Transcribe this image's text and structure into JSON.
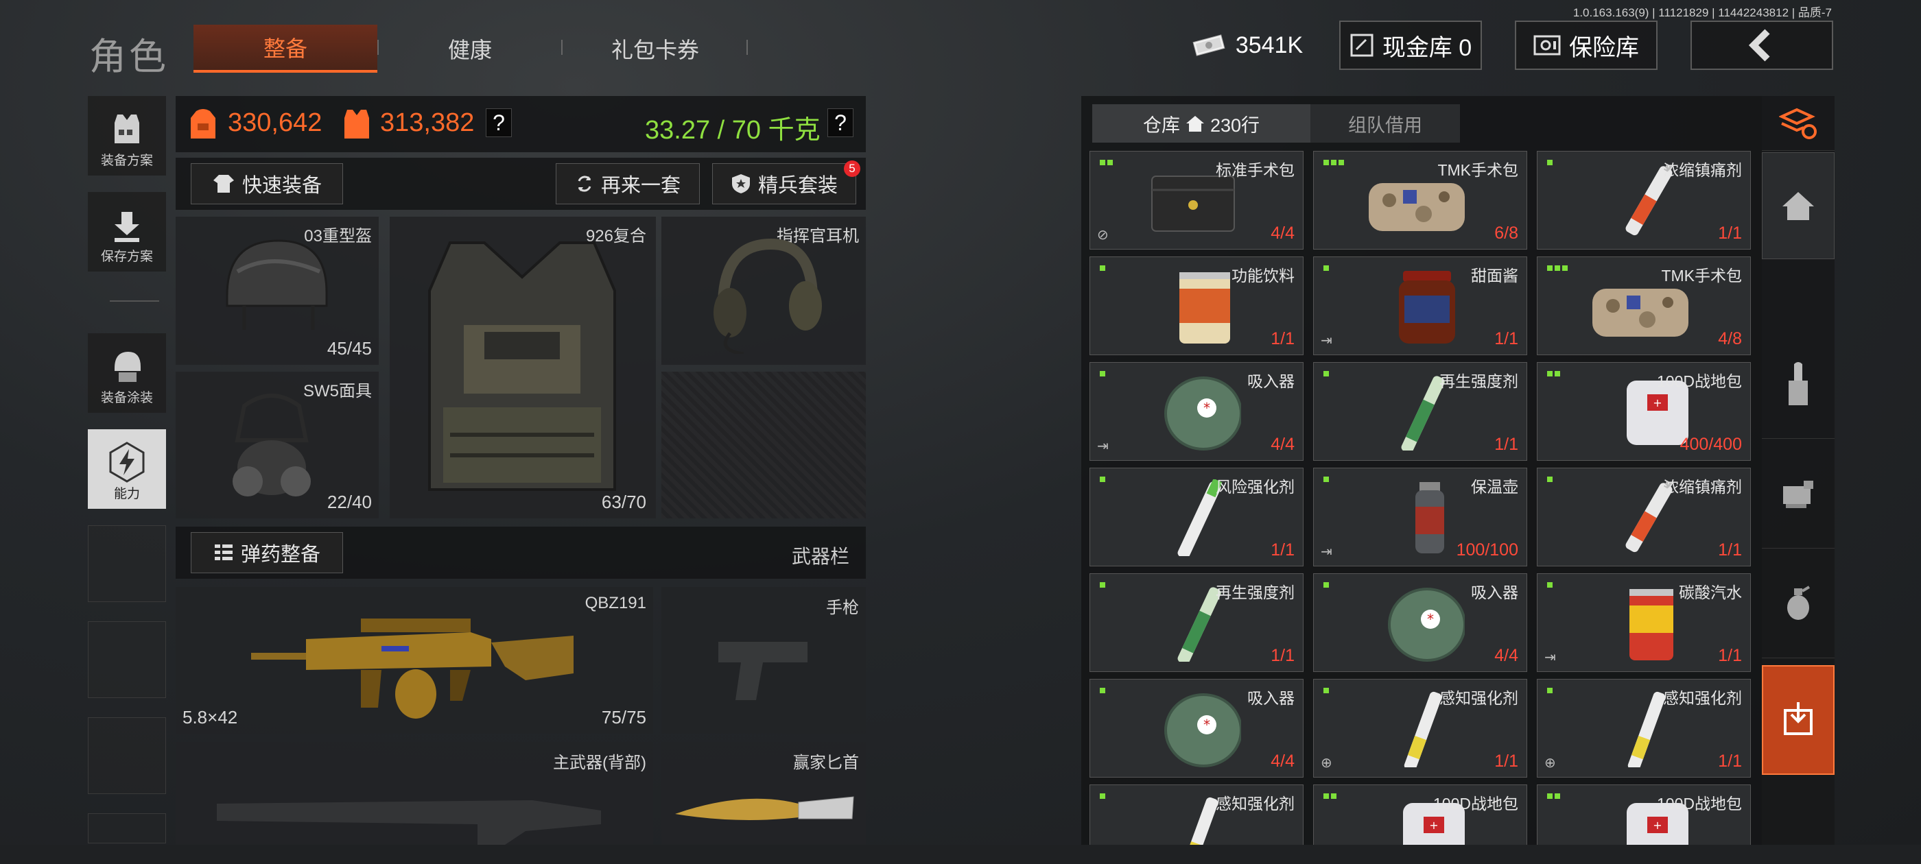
{
  "version": "1.0.163.163(9) | 11121829 | 11442243812 | 品质-7",
  "header": {
    "title": "角色",
    "tabs": [
      {
        "label": "整备",
        "active": true
      },
      {
        "label": "健康",
        "active": false
      },
      {
        "label": "礼包卡券",
        "active": false
      }
    ],
    "money": "3541K",
    "cash_vault": "现金库 0",
    "safe": "保险库"
  },
  "sidebar": [
    {
      "label": "装备方案",
      "icon": "vest-plan-icon"
    },
    {
      "label": "保存方案",
      "icon": "download-icon"
    },
    {
      "label": "装备涂装",
      "icon": "helmet-paint-icon"
    },
    {
      "label": "能力",
      "icon": "lightning-icon"
    }
  ],
  "stats": {
    "value1": "330,642",
    "value2": "313,382",
    "weight": "33.27 / 70 千克",
    "help": "?"
  },
  "actions": {
    "quick_equip": "快速装备",
    "again": "再来一套",
    "elite": "精兵套装",
    "elite_badge": "5"
  },
  "gear": {
    "helmet": {
      "name": "03重型盔",
      "dur": "45/45"
    },
    "armor": {
      "name": "926复合",
      "dur": "63/70"
    },
    "headset": {
      "name": "指挥官耳机"
    },
    "mask": {
      "name": "SW5面具",
      "dur": "22/40"
    }
  },
  "ammo_button": "弹药整备",
  "weapon_bar": "武器栏",
  "weapons": {
    "primary": {
      "name": "QBZ191",
      "caliber": "5.8×42",
      "dur": "75/75"
    },
    "pistol": {
      "name": "手枪"
    },
    "backup": {
      "name": "主武器(背部)"
    },
    "melee": {
      "name": "赢家匕首"
    }
  },
  "storage": {
    "tab1_label": "仓库",
    "tab1_rows": "230行",
    "tab2_label": "组队借用",
    "items": [
      {
        "name": "标准手术包",
        "count": "4/4",
        "grade": 2,
        "art": "black-bag",
        "corner": "⊘"
      },
      {
        "name": "TMK手术包",
        "count": "6/8",
        "grade": 3,
        "art": "camo-bag",
        "corner": ""
      },
      {
        "name": "浓缩镇痛剂",
        "count": "1/1",
        "grade": 1,
        "art": "orange-injector",
        "corner": ""
      },
      {
        "name": "功能饮料",
        "count": "1/1",
        "grade": 1,
        "art": "can",
        "corner": ""
      },
      {
        "name": "甜面酱",
        "count": "1/1",
        "grade": 1,
        "art": "jar",
        "corner": "⇥"
      },
      {
        "name": "TMK手术包",
        "count": "4/8",
        "grade": 3,
        "art": "camo-bag",
        "corner": ""
      },
      {
        "name": "吸入器",
        "count": "4/4",
        "grade": 1,
        "art": "inhaler",
        "corner": "⇥"
      },
      {
        "name": "再生强度剂",
        "count": "1/1",
        "grade": 1,
        "art": "green-injector",
        "corner": ""
      },
      {
        "name": "100D战地包",
        "count": "400/400",
        "grade": 2,
        "art": "white-bag",
        "corner": ""
      },
      {
        "name": "风险强化剂",
        "count": "1/1",
        "grade": 1,
        "art": "white-injector",
        "corner": ""
      },
      {
        "name": "保温壶",
        "count": "100/100",
        "grade": 1,
        "art": "flask",
        "corner": "⇥"
      },
      {
        "name": "浓缩镇痛剂",
        "count": "1/1",
        "grade": 1,
        "art": "orange-injector",
        "corner": ""
      },
      {
        "name": "再生强度剂",
        "count": "1/1",
        "grade": 1,
        "art": "green-injector",
        "corner": ""
      },
      {
        "name": "吸入器",
        "count": "4/4",
        "grade": 1,
        "art": "inhaler",
        "corner": ""
      },
      {
        "name": "碳酸汽水",
        "count": "1/1",
        "grade": 1,
        "art": "soda",
        "corner": "⇥"
      },
      {
        "name": "吸入器",
        "count": "4/4",
        "grade": 1,
        "art": "inhaler",
        "corner": ""
      },
      {
        "name": "感知强化剂",
        "count": "1/1",
        "grade": 1,
        "art": "yellow-injector",
        "corner": "⊕"
      },
      {
        "name": "感知强化剂",
        "count": "1/1",
        "grade": 1,
        "art": "yellow-injector",
        "corner": "⊕"
      },
      {
        "name": "感知强化剂",
        "count": "",
        "grade": 1,
        "art": "yellow-injector",
        "corner": ""
      },
      {
        "name": "100D战地包",
        "count": "",
        "grade": 2,
        "art": "white-bag",
        "corner": ""
      },
      {
        "name": "100D战地包",
        "count": "",
        "grade": 2,
        "art": "white-bag",
        "corner": ""
      }
    ]
  },
  "right_tabs": [
    "refresh-stack-icon",
    "home-icon",
    "ammo-icon",
    "scope-icon",
    "grenade-icon",
    "deposit-icon"
  ],
  "colors": {
    "accent": "#ff6a2a",
    "count_red": "#ff4a3a",
    "green": "#7ee03a",
    "weight_green": "#8fe040"
  }
}
